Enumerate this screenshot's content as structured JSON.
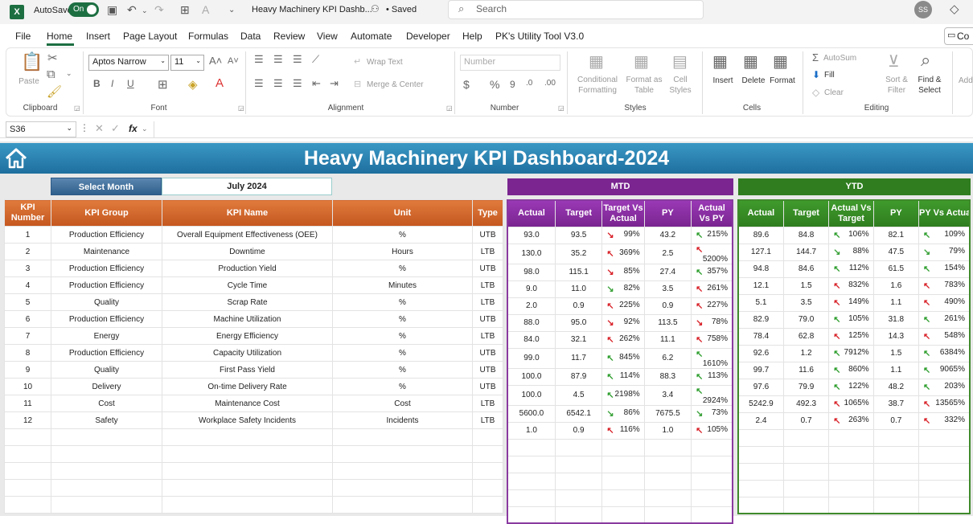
{
  "app": {
    "logo": "X",
    "autosave_label": "AutoSave",
    "autosave_state": "On",
    "doc_title": "Heavy Machinery KPI Dashb...",
    "saved": "• Saved",
    "search_placeholder": "Search",
    "avatar": "SS"
  },
  "menu": [
    "File",
    "Home",
    "Insert",
    "Page Layout",
    "Formulas",
    "Data",
    "Review",
    "View",
    "Automate",
    "Developer",
    "Help",
    "PK's Utility Tool V3.0"
  ],
  "comments": "Co",
  "ribbon": {
    "paste": "Paste",
    "clipboard": "Clipboard",
    "font_name": "Aptos Narrow",
    "font_size": "11",
    "font": "Font",
    "wrap_text": "Wrap Text",
    "merge_center": "Merge & Center",
    "alignment": "Alignment",
    "number_format": "Number",
    "number": "Number",
    "conditional_formatting": "Conditional Formatting",
    "format_as_table": "Format as Table",
    "cell_styles": "Cell Styles",
    "styles": "Styles",
    "insert": "Insert",
    "delete": "Delete",
    "format": "Format",
    "cells": "Cells",
    "autosum": "AutoSum",
    "fill": "Fill",
    "clear": "Clear",
    "sort_filter": "Sort & Filter",
    "find_select": "Find & Select",
    "editing": "Editing",
    "add": "Add"
  },
  "formula_bar": {
    "namebox": "S36",
    "fx": "fx",
    "value": ""
  },
  "dashboard": {
    "title": "Heavy Machinery KPI Dashboard-2024",
    "select_month_label": "Select Month",
    "select_month_value": "July 2024",
    "mtd": "MTD",
    "ytd": "YTD",
    "headers_main": [
      "KPI Number",
      "KPI Group",
      "KPI Name",
      "Unit",
      "Type"
    ],
    "headers_mtd": [
      "Actual",
      "Target",
      "Target Vs Actual",
      "PY",
      "Actual Vs PY"
    ],
    "headers_ytd": [
      "Actual",
      "Target",
      "Actual Vs Target",
      "PY",
      "PY Vs Actual"
    ],
    "rows": [
      {
        "num": "1",
        "group": "Production Efficiency",
        "name": "Overall Equipment Effectiveness (OEE)",
        "unit": "%",
        "type": "UTB",
        "m_act": "93.0",
        "m_tgt": "93.5",
        "m_tva_dir": "down",
        "m_tva": "99%",
        "m_py": "43.2",
        "m_avp_dir": "up",
        "m_avp": "215%",
        "y_act": "89.6",
        "y_tgt": "84.8",
        "y_avt_dir": "up",
        "y_avt": "106%",
        "y_py": "82.1",
        "y_pva_dir": "up",
        "y_pva": "109%"
      },
      {
        "num": "2",
        "group": "Maintenance",
        "name": "Downtime",
        "unit": "Hours",
        "type": "LTB",
        "m_act": "130.0",
        "m_tgt": "35.2",
        "m_tva_dir": "red-up",
        "m_tva": "369%",
        "m_py": "2.5",
        "m_avp_dir": "red-up",
        "m_avp": "5200%",
        "y_act": "127.1",
        "y_tgt": "144.7",
        "y_avt_dir": "green-down",
        "y_avt": "88%",
        "y_py": "47.5",
        "y_pva_dir": "green-down",
        "y_pva": "79%"
      },
      {
        "num": "3",
        "group": "Production Efficiency",
        "name": "Production Yield",
        "unit": "%",
        "type": "UTB",
        "m_act": "98.0",
        "m_tgt": "115.1",
        "m_tva_dir": "down",
        "m_tva": "85%",
        "m_py": "27.4",
        "m_avp_dir": "up",
        "m_avp": "357%",
        "y_act": "94.8",
        "y_tgt": "84.6",
        "y_avt_dir": "up",
        "y_avt": "112%",
        "y_py": "61.5",
        "y_pva_dir": "up",
        "y_pva": "154%"
      },
      {
        "num": "4",
        "group": "Production Efficiency",
        "name": "Cycle Time",
        "unit": "Minutes",
        "type": "LTB",
        "m_act": "9.0",
        "m_tgt": "11.0",
        "m_tva_dir": "green-down",
        "m_tva": "82%",
        "m_py": "3.5",
        "m_avp_dir": "red-up",
        "m_avp": "261%",
        "y_act": "12.1",
        "y_tgt": "1.5",
        "y_avt_dir": "red-up",
        "y_avt": "832%",
        "y_py": "1.6",
        "y_pva_dir": "red-up",
        "y_pva": "783%"
      },
      {
        "num": "5",
        "group": "Quality",
        "name": "Scrap Rate",
        "unit": "%",
        "type": "LTB",
        "m_act": "2.0",
        "m_tgt": "0.9",
        "m_tva_dir": "red-up",
        "m_tva": "225%",
        "m_py": "0.9",
        "m_avp_dir": "red-up",
        "m_avp": "227%",
        "y_act": "5.1",
        "y_tgt": "3.5",
        "y_avt_dir": "red-up",
        "y_avt": "149%",
        "y_py": "1.1",
        "y_pva_dir": "red-up",
        "y_pva": "490%"
      },
      {
        "num": "6",
        "group": "Production Efficiency",
        "name": "Machine Utilization",
        "unit": "%",
        "type": "UTB",
        "m_act": "88.0",
        "m_tgt": "95.0",
        "m_tva_dir": "down",
        "m_tva": "92%",
        "m_py": "113.5",
        "m_avp_dir": "down",
        "m_avp": "78%",
        "y_act": "82.9",
        "y_tgt": "79.0",
        "y_avt_dir": "up",
        "y_avt": "105%",
        "y_py": "31.8",
        "y_pva_dir": "up",
        "y_pva": "261%"
      },
      {
        "num": "7",
        "group": "Energy",
        "name": "Energy Efficiency",
        "unit": "%",
        "type": "LTB",
        "m_act": "84.0",
        "m_tgt": "32.1",
        "m_tva_dir": "red-up",
        "m_tva": "262%",
        "m_py": "11.1",
        "m_avp_dir": "red-up",
        "m_avp": "758%",
        "y_act": "78.4",
        "y_tgt": "62.8",
        "y_avt_dir": "red-up",
        "y_avt": "125%",
        "y_py": "14.3",
        "y_pva_dir": "red-up",
        "y_pva": "548%"
      },
      {
        "num": "8",
        "group": "Production Efficiency",
        "name": "Capacity Utilization",
        "unit": "%",
        "type": "UTB",
        "m_act": "99.0",
        "m_tgt": "11.7",
        "m_tva_dir": "up",
        "m_tva": "845%",
        "m_py": "6.2",
        "m_avp_dir": "up",
        "m_avp": "1610%",
        "y_act": "92.6",
        "y_tgt": "1.2",
        "y_avt_dir": "up",
        "y_avt": "7912%",
        "y_py": "1.5",
        "y_pva_dir": "up",
        "y_pva": "6384%"
      },
      {
        "num": "9",
        "group": "Quality",
        "name": "First Pass Yield",
        "unit": "%",
        "type": "UTB",
        "m_act": "100.0",
        "m_tgt": "87.9",
        "m_tva_dir": "up",
        "m_tva": "114%",
        "m_py": "88.3",
        "m_avp_dir": "up",
        "m_avp": "113%",
        "y_act": "99.7",
        "y_tgt": "11.6",
        "y_avt_dir": "up",
        "y_avt": "860%",
        "y_py": "1.1",
        "y_pva_dir": "up",
        "y_pva": "9065%"
      },
      {
        "num": "10",
        "group": "Delivery",
        "name": "On-time Delivery Rate",
        "unit": "%",
        "type": "UTB",
        "m_act": "100.0",
        "m_tgt": "4.5",
        "m_tva_dir": "up",
        "m_tva": "2198%",
        "m_py": "3.4",
        "m_avp_dir": "up",
        "m_avp": "2924%",
        "y_act": "97.6",
        "y_tgt": "79.9",
        "y_avt_dir": "up",
        "y_avt": "122%",
        "y_py": "48.2",
        "y_pva_dir": "up",
        "y_pva": "203%"
      },
      {
        "num": "11",
        "group": "Cost",
        "name": "Maintenance Cost",
        "unit": "Cost",
        "type": "LTB",
        "m_act": "5600.0",
        "m_tgt": "6542.1",
        "m_tva_dir": "green-down",
        "m_tva": "86%",
        "m_py": "7675.5",
        "m_avp_dir": "green-down",
        "m_avp": "73%",
        "y_act": "5242.9",
        "y_tgt": "492.3",
        "y_avt_dir": "red-up",
        "y_avt": "1065%",
        "y_py": "38.7",
        "y_pva_dir": "red-up",
        "y_pva": "13565%"
      },
      {
        "num": "12",
        "group": "Safety",
        "name": "Workplace Safety Incidents",
        "unit": "Incidents",
        "type": "LTB",
        "m_act": "1.0",
        "m_tgt": "0.9",
        "m_tva_dir": "red-up",
        "m_tva": "116%",
        "m_py": "1.0",
        "m_avp_dir": "red-up",
        "m_avp": "105%",
        "y_act": "2.4",
        "y_tgt": "0.7",
        "y_avt_dir": "red-up",
        "y_avt": "263%",
        "y_py": "0.7",
        "y_pva_dir": "red-up",
        "y_pva": "332%"
      }
    ],
    "empty_rows": 5
  }
}
